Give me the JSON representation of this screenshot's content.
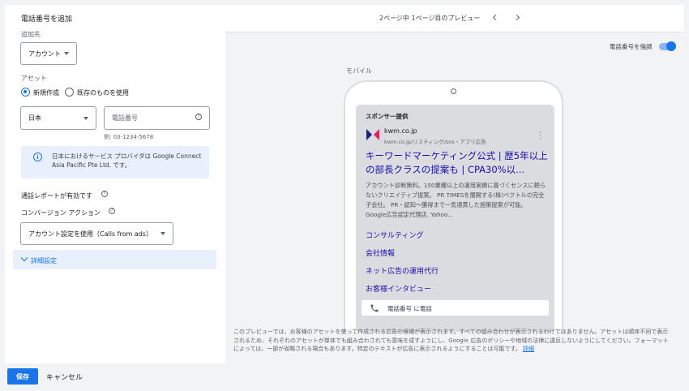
{
  "left_panel": {
    "title": "電話番号を追加",
    "add_to_label": "追加先",
    "add_to_value": "アカウント",
    "asset_label": "アセット",
    "radio_new": "新規作成",
    "radio_existing": "既存のものを使用",
    "country_value": "日本",
    "phone_placeholder": "電話番号",
    "phone_example": "例: 03-1234-5678",
    "info_text": "日本におけるサービス プロバイダは Google Connect Asia Pacific Pte Ltd. です。",
    "call_report_label": "通話レポートが有効です",
    "conversion_label": "コンバージョン アクション",
    "conversion_value": "アカウント設定を使用（Calls from ads）",
    "advanced_label": "詳細設定"
  },
  "preview": {
    "pager_text": "2ページ中 1ページ目のプレビュー",
    "toggle_label": "電話番号を強調",
    "mobile_label": "モバイル",
    "ad": {
      "sponsor": "スポンサー提供",
      "domain": "kwm.co.jp",
      "url": "kwm.co.jp/リスティング/sns・アプリ広告",
      "headline": "キーワードマーケティング公式 | 歴5年以上の部長クラスの提案も | CPA30%以...",
      "description": "アカウント診断無料。150業種以上の運用実績に基づくセンスに頼らないクリエイティブ提案。 PR TIMESを展開する(株)ベクトルの完全子会社。 PR・認知〜獲得まで一気通貫した施策提案が可能。 Google広告認定代理店. Yahoo...",
      "sitelinks": [
        "コンサルティング",
        "会社情報",
        "ネット広告の運用代行",
        "お客様インタビュー"
      ],
      "call_text": "電話番号 に電話"
    },
    "disclaimer": "このプレビューでは、お客様のアセットを使って作成される広告の候補が表示されます。すべての組み合わせが表示されるわけではありません。アセットは順序不同で表示されるため、それぞれのアセットが単体でも組み合わされても意味を成すようにし、Google 広告のポリシーや地域の法律に違反しないようにしてください。フォーマットによっては、一部が省略される場合もあります。特定のテキストが広告に表示されるようにすることは可能です。",
    "disclaimer_link": "詳細"
  },
  "footer": {
    "save_label": "保存",
    "cancel_label": "キャンセル"
  },
  "colors": {
    "accent": "#1a73e8",
    "ad_link": "#1a0dab",
    "info_bg": "#e8f0fe"
  }
}
